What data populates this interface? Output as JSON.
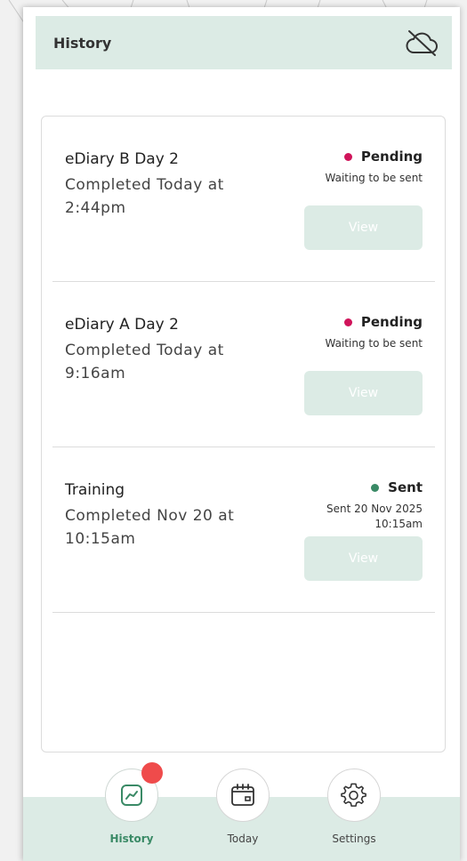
{
  "header": {
    "title": "History",
    "cloud_icon": "cloud-off-icon"
  },
  "entries": [
    {
      "title": "eDiary B Day 2",
      "subtitle": "Completed Today at 2:44pm",
      "status": "Pending",
      "status_color": "#d0145a",
      "detail": "Waiting to be sent",
      "button": "View"
    },
    {
      "title": "eDiary A Day 2",
      "subtitle": "Completed Today at 9:16am",
      "status": "Pending",
      "status_color": "#d0145a",
      "detail": "Waiting to be sent",
      "button": "View"
    },
    {
      "title": "Training",
      "subtitle": "Completed Nov 20 at 10:15am",
      "status": "Sent",
      "status_color": "#3a8a66",
      "detail": "Sent 20 Nov 2025\n10:15am",
      "button": "View"
    }
  ],
  "nav": {
    "items": [
      {
        "label": "History",
        "icon": "chart-icon",
        "active": true,
        "badge": true
      },
      {
        "label": "Today",
        "icon": "calendar-icon",
        "active": false
      },
      {
        "label": "Settings",
        "icon": "gear-icon",
        "active": false
      }
    ]
  },
  "colors": {
    "accent": "#3a8a66",
    "header_bg": "#dcebe5",
    "badge": "#ef4b4b"
  }
}
